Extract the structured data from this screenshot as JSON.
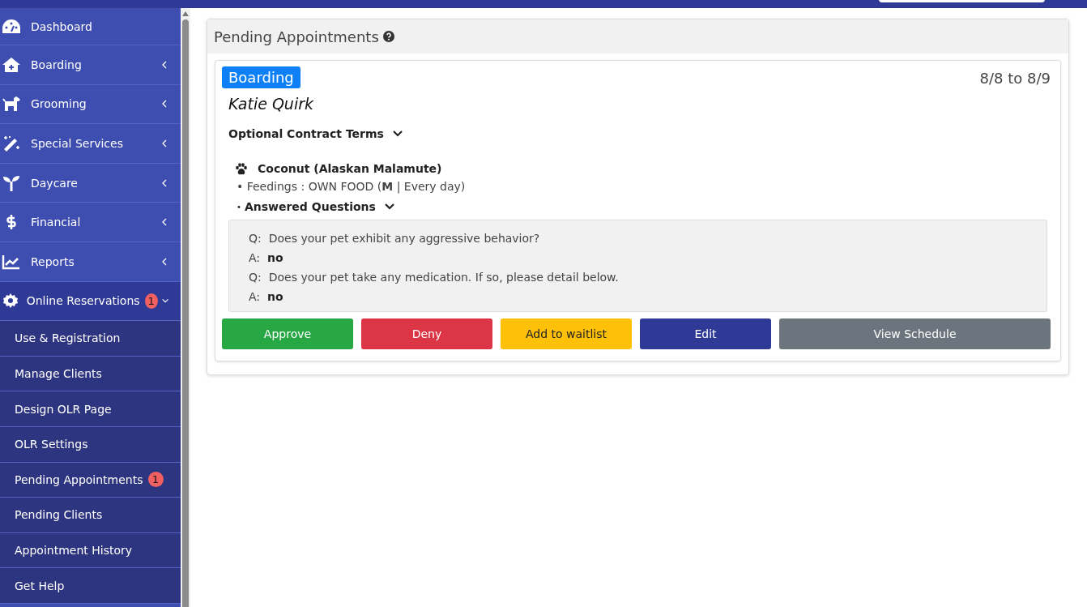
{
  "sidebar": {
    "items": [
      {
        "label": "Dashboard"
      },
      {
        "label": "Boarding",
        "expanded": false
      },
      {
        "label": "Grooming",
        "expanded": false
      },
      {
        "label": "Special Services",
        "expanded": false
      },
      {
        "label": "Daycare",
        "expanded": false
      },
      {
        "label": "Financial",
        "expanded": false
      },
      {
        "label": "Reports",
        "expanded": false
      },
      {
        "label": "Online Reservations",
        "expanded": true,
        "badge": "1",
        "children": [
          {
            "label": "Use & Registration"
          },
          {
            "label": "Manage Clients"
          },
          {
            "label": "Design OLR Page"
          },
          {
            "label": "OLR Settings"
          },
          {
            "label": "Pending Appointments",
            "badge": "1"
          },
          {
            "label": "Pending Clients"
          },
          {
            "label": "Appointment History"
          },
          {
            "label": "Get Help"
          }
        ]
      }
    ]
  },
  "panel": {
    "title": "Pending Appointments",
    "appointment": {
      "service": "Boarding",
      "dates": "8/8 to 8/9",
      "client": "Katie Quirk",
      "contract_terms": "Optional Contract Terms",
      "pet": "Coconut (Alaskan Malamute)",
      "feeding": "• Feedings :  OWN FOOD (**M** | Every day)",
      "questions_bullet": "•",
      "questions_label": "Answered Questions",
      "qa": [
        {
          "kind": "question",
          "prefix": "Q:",
          "text": "Does your pet exhibit any aggressive behavior?"
        },
        {
          "kind": "answer",
          "prefix": "A:",
          "text": "no"
        },
        {
          "kind": "question",
          "prefix": "Q:",
          "text": "Does your pet take any medication. If so, please detail below."
        },
        {
          "kind": "answer",
          "prefix": "A:",
          "text": "no"
        }
      ],
      "buttons": [
        {
          "label": "Approve",
          "kind": "success"
        },
        {
          "label": "Deny",
          "kind": "danger"
        },
        {
          "label": "Add to waitlist",
          "kind": "warning"
        },
        {
          "label": "Edit",
          "kind": "primary"
        },
        {
          "label": "View Schedule",
          "kind": "secondary"
        }
      ]
    }
  }
}
